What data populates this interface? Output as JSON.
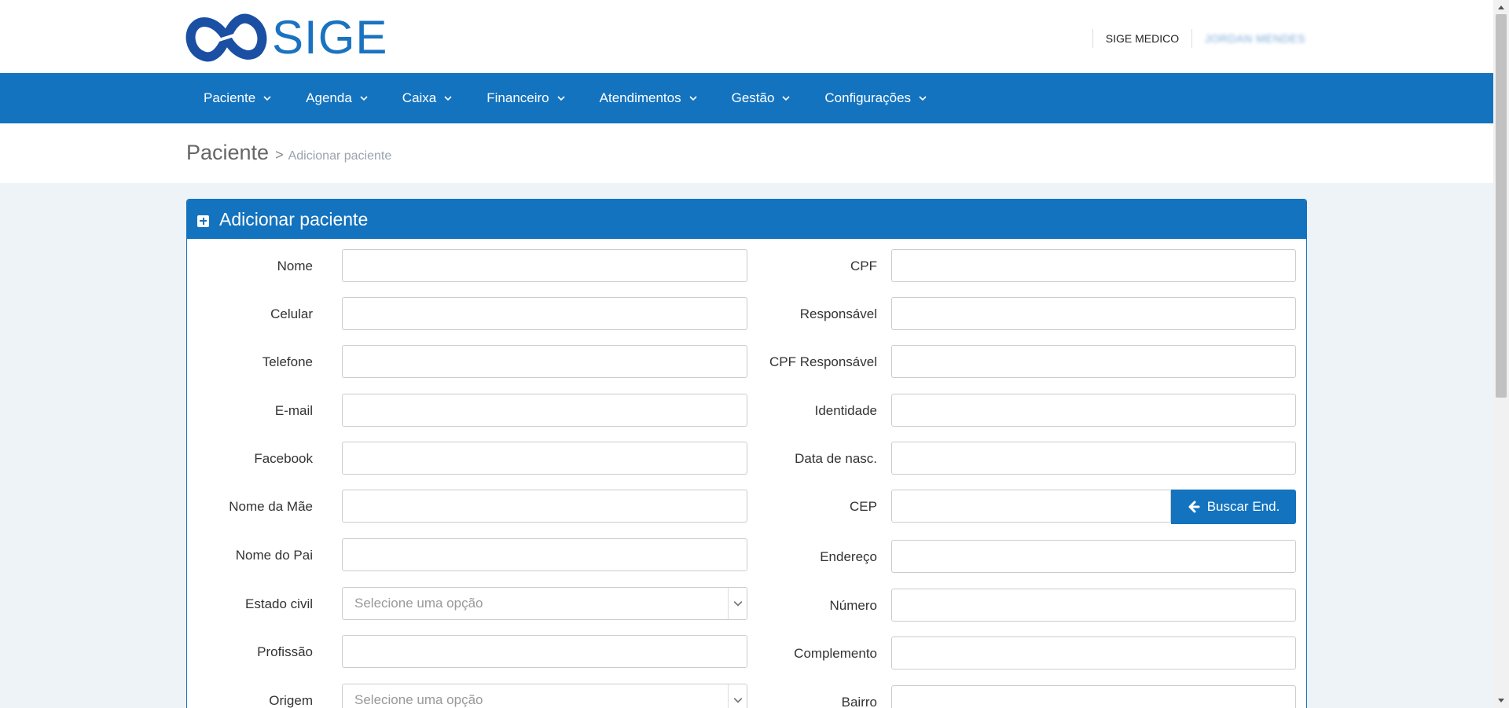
{
  "brand": {
    "name": "SIGE"
  },
  "user": {
    "org": "SIGE MEDICO",
    "name": "JORDAN MENDES"
  },
  "nav": {
    "items": [
      "Paciente",
      "Agenda",
      "Caixa",
      "Financeiro",
      "Atendimentos",
      "Gestão",
      "Configurações"
    ]
  },
  "breadcrumb": {
    "title": "Paciente",
    "separator": ">",
    "current": "Adicionar paciente"
  },
  "panel": {
    "title": "Adicionar paciente"
  },
  "form": {
    "left": {
      "nome": "Nome",
      "celular": "Celular",
      "telefone": "Telefone",
      "email": "E-mail",
      "facebook": "Facebook",
      "mae": "Nome da Mãe",
      "pai": "Nome do Pai",
      "estado_civil": "Estado civil",
      "profissao": "Profissão",
      "origem": "Origem"
    },
    "right": {
      "cpf": "CPF",
      "responsavel": "Responsável",
      "cpf_responsavel": "CPF Responsável",
      "identidade": "Identidade",
      "nascimento": "Data de nasc.",
      "cep": "CEP",
      "endereco": "Endereço",
      "numero": "Número",
      "complemento": "Complemento",
      "bairro": "Bairro"
    },
    "select_placeholder": "Selecione uma opção",
    "cep_button": "Buscar End."
  },
  "colors": {
    "primary": "#1373bf",
    "background": "#eef3f8"
  }
}
